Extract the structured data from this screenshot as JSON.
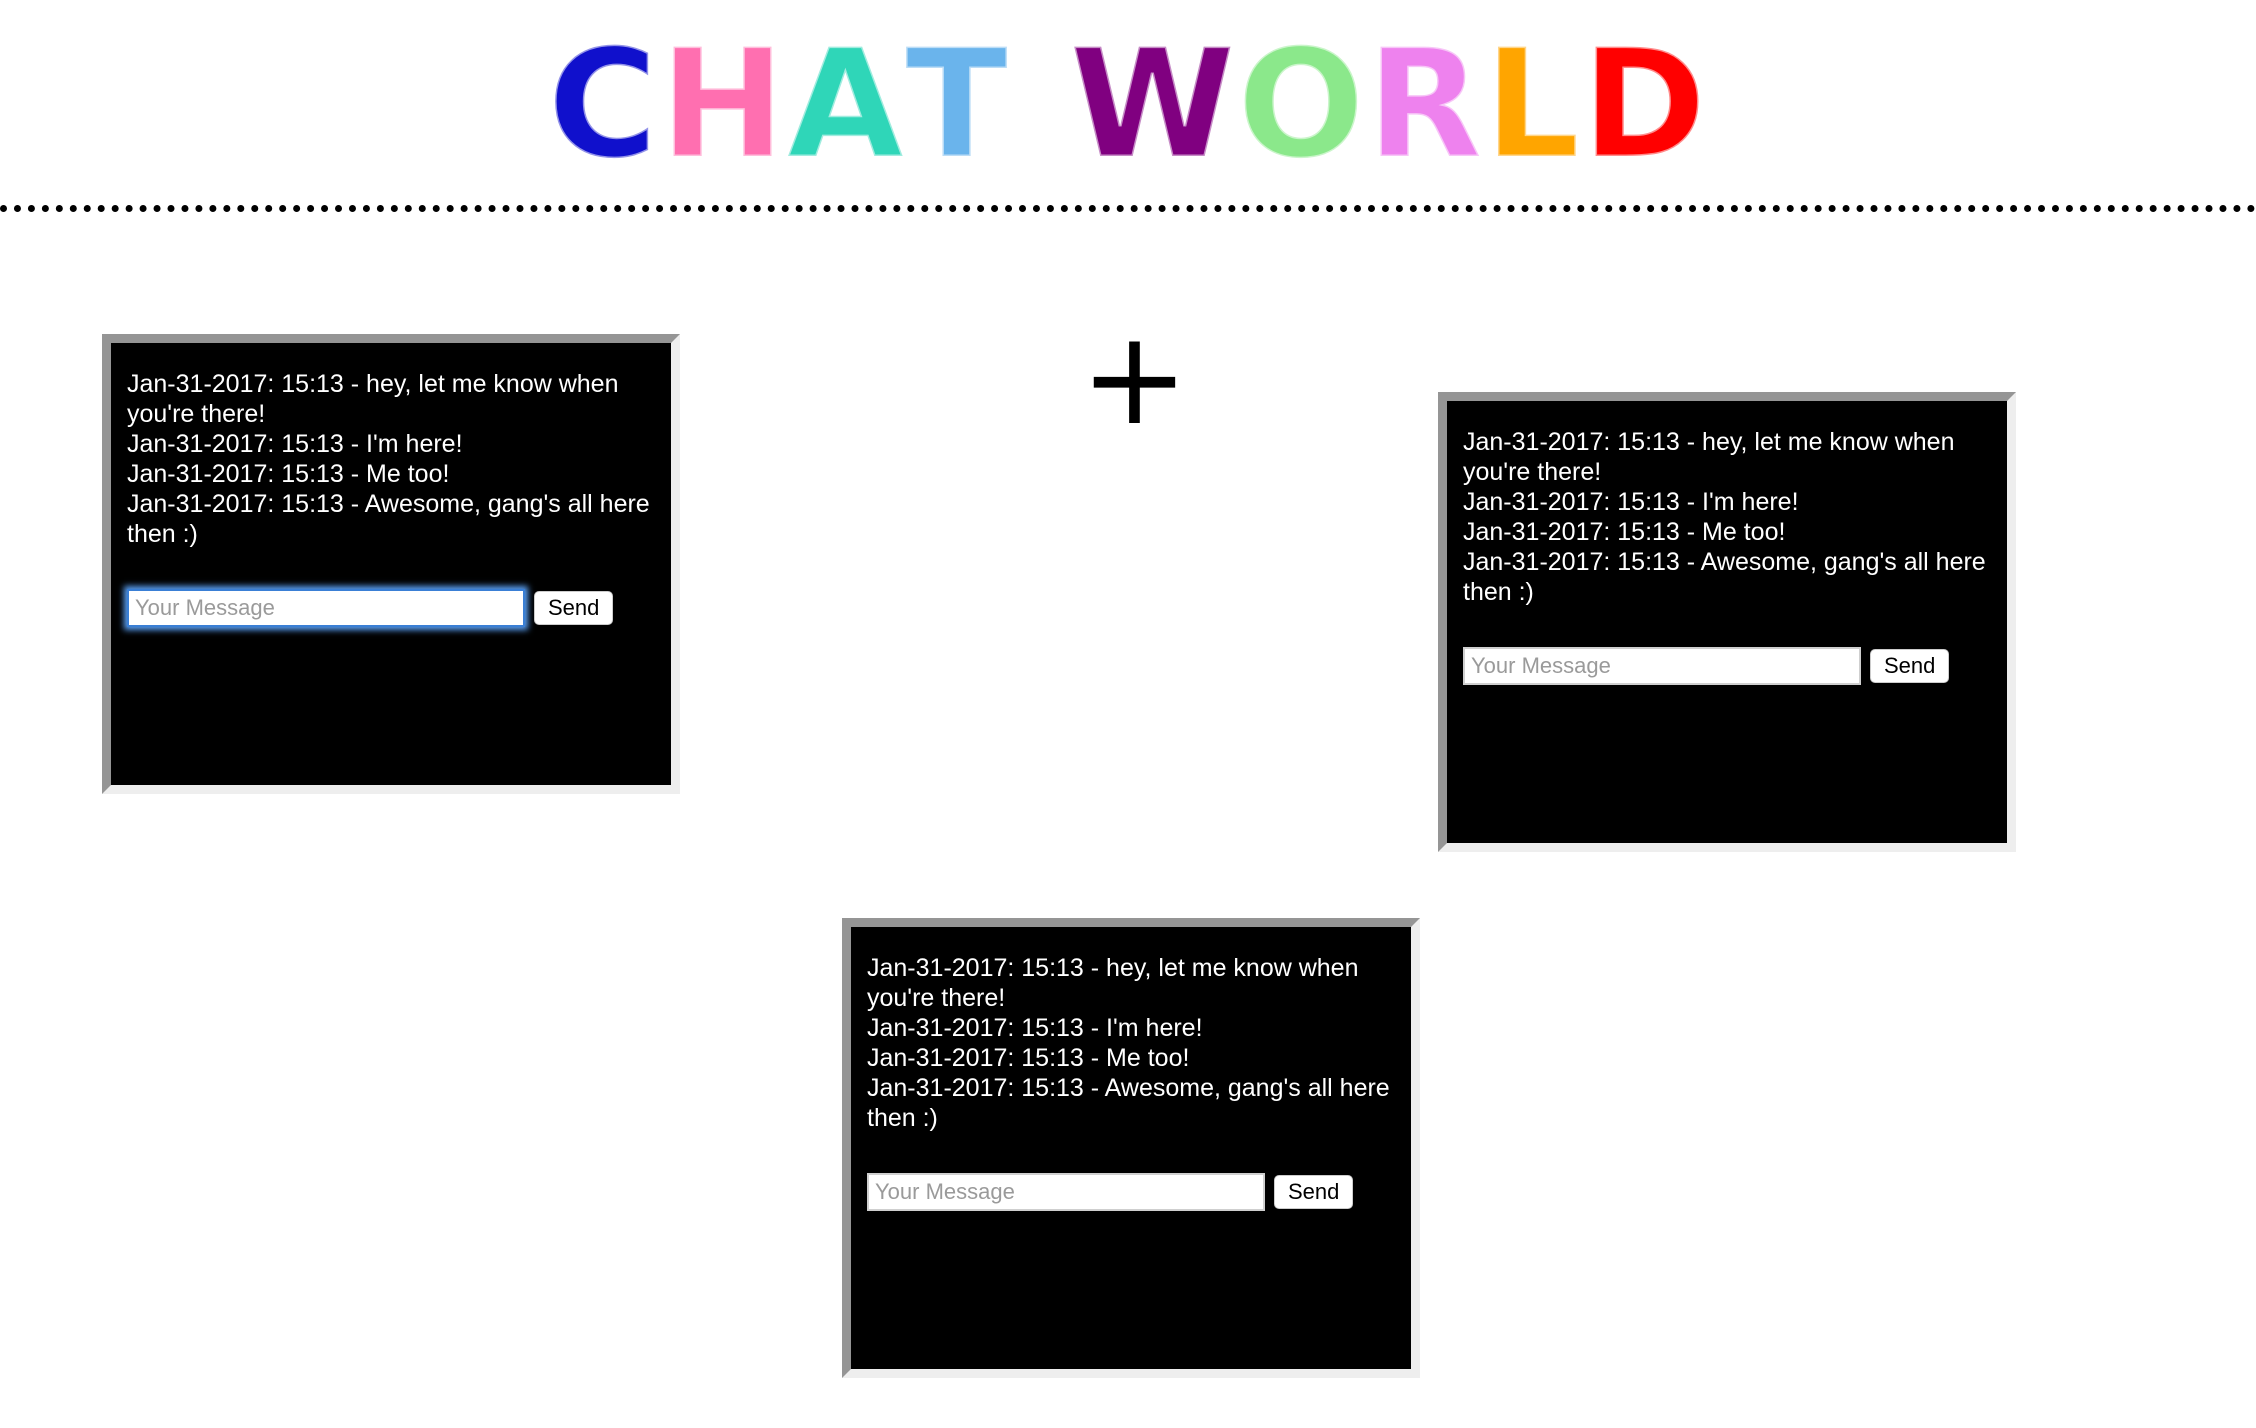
{
  "title": {
    "letters": [
      {
        "char": "C",
        "color": "#1010cc"
      },
      {
        "char": "H",
        "color": "#ff6fb0"
      },
      {
        "char": "A",
        "color": "#2fd6b8"
      },
      {
        "char": "T",
        "color": "#6ab4ec"
      },
      {
        "char": "W",
        "color": "#800080"
      },
      {
        "char": "O",
        "color": "#8be88b"
      },
      {
        "char": "R",
        "color": "#ee82ee"
      },
      {
        "char": "L",
        "color": "#ffa500"
      },
      {
        "char": "D",
        "color": "#ff0000"
      }
    ]
  },
  "plus_symbol": "+",
  "chat_windows": [
    {
      "messages": [
        "Jan-31-2017: 15:13 - hey, let me know when you're there!",
        "Jan-31-2017: 15:13 - I'm here!",
        "Jan-31-2017: 15:13 - Me too!",
        "Jan-31-2017: 15:13 - Awesome, gang's all here then :)"
      ],
      "input_placeholder": "Your Message",
      "input_value": "",
      "send_label": "Send"
    },
    {
      "messages": [
        "Jan-31-2017: 15:13 - hey, let me know when you're there!",
        "Jan-31-2017: 15:13 - I'm here!",
        "Jan-31-2017: 15:13 - Me too!",
        "Jan-31-2017: 15:13 - Awesome, gang's all here then :)"
      ],
      "input_placeholder": "Your Message",
      "input_value": "",
      "send_label": "Send"
    },
    {
      "messages": [
        "Jan-31-2017: 15:13 - hey, let me know when you're there!",
        "Jan-31-2017: 15:13 - I'm here!",
        "Jan-31-2017: 15:13 - Me too!",
        "Jan-31-2017: 15:13 - Awesome, gang's all here then :)"
      ],
      "input_placeholder": "Your Message",
      "input_value": "",
      "send_label": "Send"
    }
  ]
}
